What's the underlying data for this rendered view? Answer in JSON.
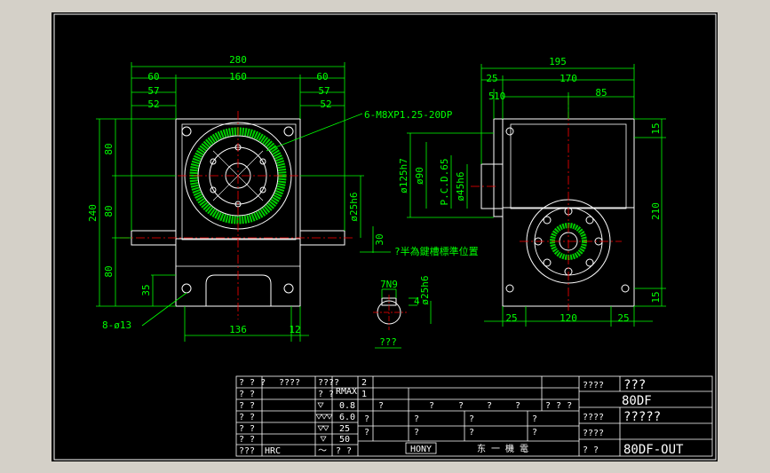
{
  "colors": {
    "background": "#d4d0c8",
    "sheet": "#000000",
    "dimension": "#00ff00",
    "outline": "#ffffff",
    "center": "#ff0000",
    "hatch": "#00cc00",
    "frame": "#ffffff"
  },
  "front_view": {
    "dims": {
      "overall_width": "280",
      "center_width": "160",
      "left_60": "60",
      "right_60": "60",
      "left_57": "57",
      "right_57": "57",
      "left_52": "52",
      "right_52": "52",
      "height_240": "240",
      "v_80_top": "80",
      "v_80_mid": "80",
      "v_80_bot": "80",
      "v_35": "35",
      "bottom_136": "136",
      "bottom_12": "12",
      "d25h6": "ø25h6",
      "v_30": "30",
      "holes": "8-ø13",
      "tapped": "6-M8XP1.25-20DP"
    }
  },
  "side_view": {
    "dims": {
      "overall_195": "195",
      "d_25": "25",
      "d_170": "170",
      "d_85": "85",
      "d_5": "5",
      "d_10": "10",
      "d125h7": "ø125h7",
      "d90": "ø90",
      "pcd": "P.C.D.65",
      "d45h6": "ø45h6",
      "v_15_top": "15",
      "v_210": "210",
      "v_15_bot": "15",
      "b_25_left": "25",
      "b_120": "120",
      "b_25_right": "25"
    },
    "note": "?半為鍵槽標準位置"
  },
  "detail": {
    "key_label": "7N9",
    "dia_label": "ø25h6",
    "v4": "4",
    "title": "???"
  },
  "title_block": {
    "left_table": {
      "r1": [
        "? ? ?",
        "????",
        "????"
      ],
      "r2": [
        "? ?",
        "? ?",
        "RMAX"
      ],
      "r3": [
        "? ?",
        "0.8"
      ],
      "r4": [
        "? ?",
        "6.0"
      ],
      "r5": [
        "? ?",
        "25"
      ],
      "r6": [
        "? ?",
        "50"
      ],
      "r7": [
        "???",
        "HRC",
        "～",
        "? ?"
      ]
    },
    "revision": {
      "rev2": "2",
      "rev1": "1",
      "marks": [
        "?",
        "?",
        "?",
        "?",
        "?",
        "? ? ?"
      ],
      "sub_marks": [
        "?",
        "?",
        "?",
        "?",
        "?",
        "?",
        "?",
        "?"
      ],
      "brand": "HONY",
      "company": "东 一 機 電"
    },
    "right_table": {
      "r1_label": "????",
      "r1_value": "???",
      "r2_value": "80DF",
      "r3_label": "????",
      "r3_value": "?????",
      "r4_label": "????",
      "r5_label": "?   ?",
      "r5_value": "80DF-OUT"
    }
  }
}
